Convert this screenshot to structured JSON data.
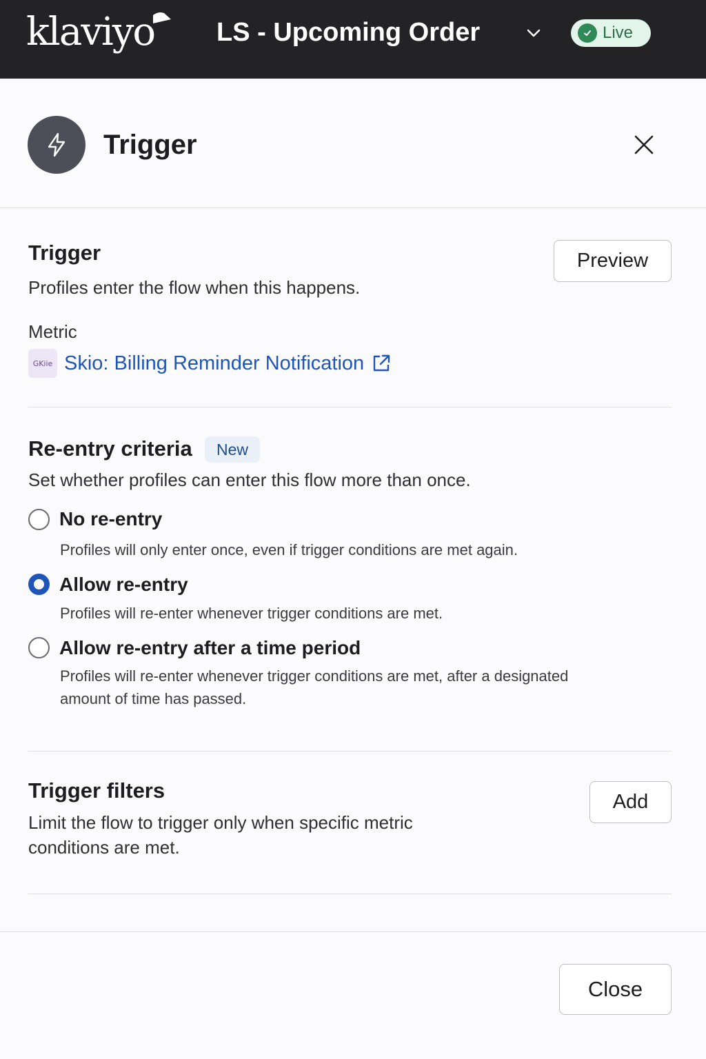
{
  "topbar": {
    "logo": "klaviyo",
    "flow_title": "LS - Upcoming Order",
    "status": "Live",
    "status_color": "#2f8a57"
  },
  "panel": {
    "title": "Trigger",
    "icon": "lightning-icon",
    "close_icon": "close-icon"
  },
  "trigger_section": {
    "title": "Trigger",
    "description": "Profiles enter the flow when this happens.",
    "preview_label": "Preview",
    "metric_label": "Metric",
    "metric_logo_text": "GKiie",
    "metric_name": "Skio: Billing Reminder Notification",
    "link_icon": "external-link-icon",
    "link_color": "#1f55b8"
  },
  "reentry_section": {
    "title": "Re-entry criteria",
    "badge": "New",
    "description": "Set whether profiles can enter this flow more than once.",
    "options": [
      {
        "label": "No re-entry",
        "help": "Profiles will only enter once, even if trigger conditions are met again.",
        "checked": false
      },
      {
        "label": "Allow re-entry",
        "help": "Profiles will re-enter whenever trigger conditions are met.",
        "checked": true
      },
      {
        "label": "Allow re-entry after a time period",
        "help": "Profiles will re-enter whenever trigger conditions are met, after a designated amount of time has passed.",
        "checked": false
      }
    ]
  },
  "filters_section": {
    "title": "Trigger filters",
    "description": "Limit the flow to trigger only when specific metric conditions are met.",
    "add_label": "Add"
  },
  "footer": {
    "close_label": "Close"
  }
}
